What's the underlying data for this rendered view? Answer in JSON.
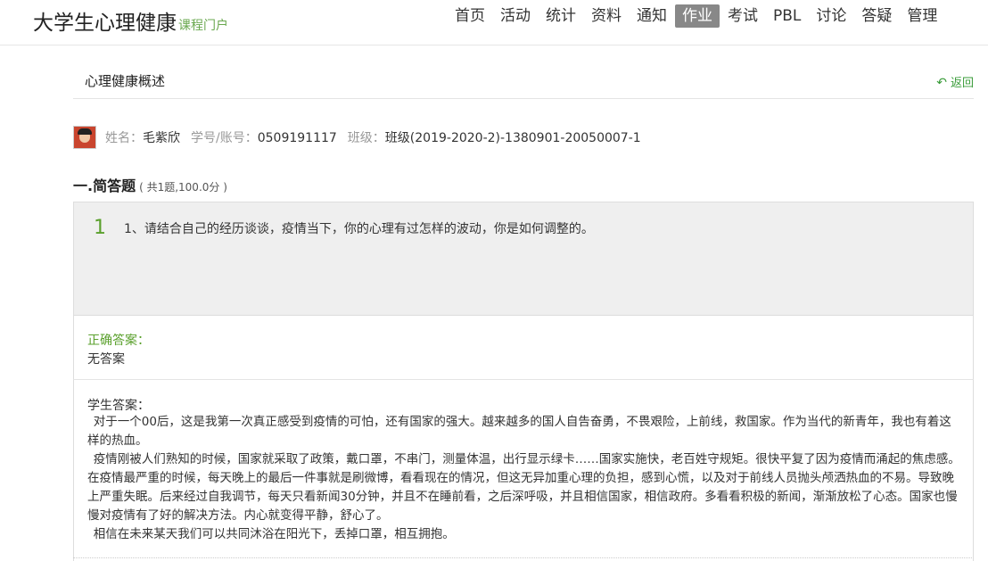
{
  "header": {
    "logo_main": "大学生心理健康",
    "logo_sub": "课程门户",
    "nav": [
      "首页",
      "活动",
      "统计",
      "资料",
      "通知",
      "作业",
      "考试",
      "PBL",
      "讨论",
      "答疑",
      "管理"
    ],
    "active_nav": "作业"
  },
  "page": {
    "title": "心理健康概述",
    "back_label": "返回"
  },
  "user": {
    "name_label": "姓名：",
    "name": "毛紫欣",
    "id_label": "学号/账号：",
    "id": "0509191117",
    "class_label": "班级：",
    "class": "班级(2019-2020-2)-1380901-20050007-1"
  },
  "section": {
    "name": "一.简答题",
    "meta": "( 共1题,100.0分 )"
  },
  "question": {
    "number": "1",
    "text": "1、请结合自己的经历谈谈，疫情当下，你的心理有过怎样的波动，你是如何调整的。"
  },
  "correct_answer": {
    "label": "正确答案：",
    "value": "无答案"
  },
  "student_answer": {
    "label": "学生答案：",
    "paragraphs": [
      "对于一个00后，这是我第一次真正感受到疫情的可怕，还有国家的强大。越来越多的国人自告奋勇，不畏艰险，上前线，救国家。作为当代的新青年，我也有着这样的热血。",
      "疫情刚被人们熟知的时候，国家就采取了政策，戴口罩，不串门，测量体温，出行显示绿卡……国家实施快，老百姓守规矩。很快平复了因为疫情而涌起的焦虑感。在疫情最严重的时候，每天晚上的最后一件事就是刷微博，看看现在的情况，但这无异加重心理的负担，感到心慌，以及对于前线人员抛头颅洒热血的不易。导致晚上严重失眠。后来经过自我调节，每天只看新闻30分钟，并且不在睡前看，之后深呼吸，并且相信国家，相信政府。多看看积极的新闻，渐渐放松了心态。国家也慢慢对疫情有了好的解决方法。内心就变得平静，舒心了。",
      "相信在未来某天我们可以共同沐浴在阳光下，丢掉口罩，相互拥抱。"
    ]
  }
}
